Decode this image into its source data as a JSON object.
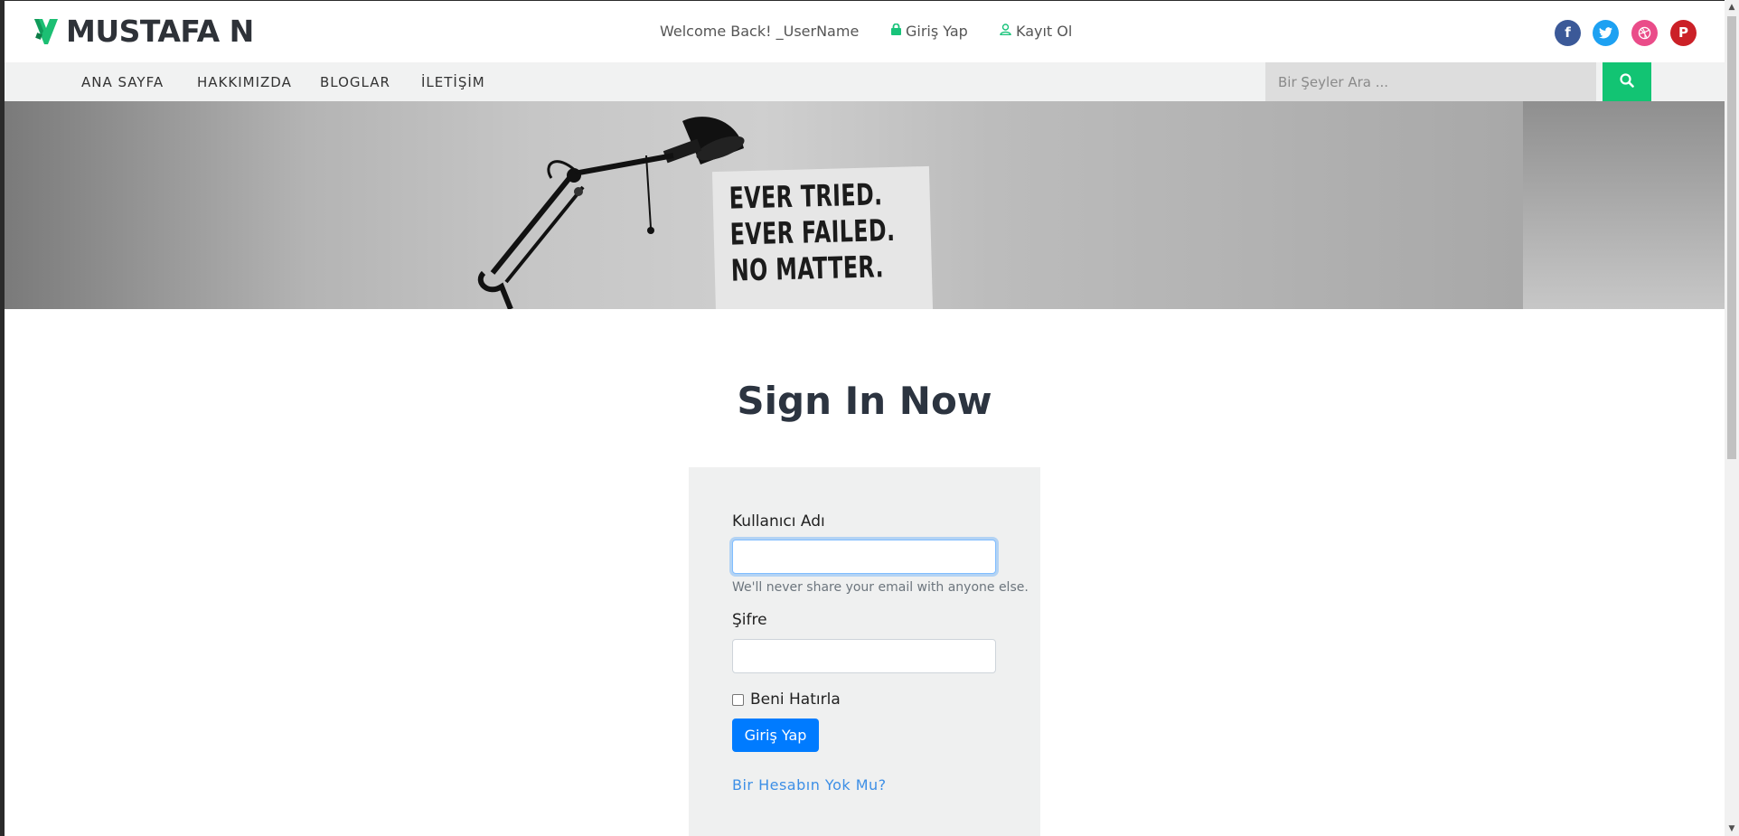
{
  "brand": {
    "name": "MUSTAFA N"
  },
  "header": {
    "welcome": "Welcome Back! _UserName",
    "login_label": "Giriş Yap",
    "register_label": "Kayıt Ol",
    "social": [
      {
        "name": "facebook",
        "glyph": "f",
        "color": "#3b5998"
      },
      {
        "name": "twitter",
        "glyph": "t",
        "color": "#1da1f2"
      },
      {
        "name": "dribbble",
        "glyph": "◎",
        "color": "#ea4c89"
      },
      {
        "name": "pinterest",
        "glyph": "P",
        "color": "#cb2027"
      }
    ]
  },
  "nav": {
    "items": [
      "ANA SAYFA",
      "HAKKIMIZDA",
      "BLOGLAR",
      "İLETİŞİM"
    ],
    "search_placeholder": "Bir Şeyler Ara ..."
  },
  "hero": {
    "poster_lines": [
      "EVER TRIED.",
      "EVER FAILED.",
      "NO MATTER."
    ]
  },
  "signin": {
    "title": "Sign In Now",
    "username_label": "Kullanıcı Adı",
    "username_value": "",
    "help_text": "We'll never share your email with anyone else.",
    "password_label": "Şifre",
    "password_value": "",
    "remember_label": "Beni Hatırla",
    "remember_checked": false,
    "submit_label": "Giriş Yap",
    "register_link": "Bir Hesabın Yok Mu?"
  },
  "colors": {
    "accent": "#12c473",
    "primary_button": "#007bff",
    "link": "#3d8fe6"
  }
}
